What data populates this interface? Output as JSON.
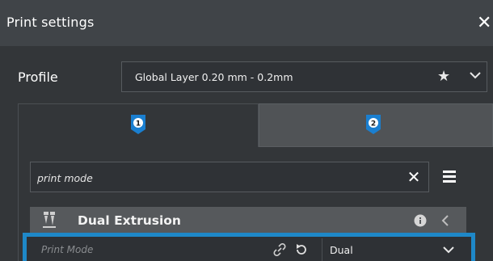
{
  "dialog": {
    "title": "Print settings",
    "close_icon": "close-icon"
  },
  "profile": {
    "label": "Profile",
    "value": "Global Layer 0.20 mm - 0.2mm",
    "star_glyph": "★"
  },
  "tabs": [
    {
      "label": "1",
      "active": true
    },
    {
      "label": "2",
      "active": false
    }
  ],
  "search": {
    "value": "print mode",
    "clear_glyph": "✕"
  },
  "group": {
    "title": "Dual Extrusion"
  },
  "setting": {
    "label": "Print Mode",
    "value": "Dual"
  },
  "colors": {
    "accent": "#1e88c8",
    "badge": "#1a7fd0"
  }
}
